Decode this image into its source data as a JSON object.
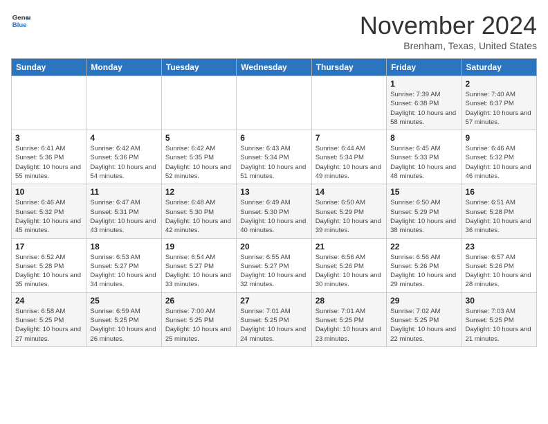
{
  "header": {
    "logo": {
      "general": "General",
      "blue": "Blue"
    },
    "title": "November 2024",
    "location": "Brenham, Texas, United States"
  },
  "weekdays": [
    "Sunday",
    "Monday",
    "Tuesday",
    "Wednesday",
    "Thursday",
    "Friday",
    "Saturday"
  ],
  "weeks": [
    [
      {
        "day": "",
        "info": ""
      },
      {
        "day": "",
        "info": ""
      },
      {
        "day": "",
        "info": ""
      },
      {
        "day": "",
        "info": ""
      },
      {
        "day": "",
        "info": ""
      },
      {
        "day": "1",
        "info": "Sunrise: 7:39 AM\nSunset: 6:38 PM\nDaylight: 10 hours and 58 minutes."
      },
      {
        "day": "2",
        "info": "Sunrise: 7:40 AM\nSunset: 6:37 PM\nDaylight: 10 hours and 57 minutes."
      }
    ],
    [
      {
        "day": "3",
        "info": "Sunrise: 6:41 AM\nSunset: 5:36 PM\nDaylight: 10 hours and 55 minutes."
      },
      {
        "day": "4",
        "info": "Sunrise: 6:42 AM\nSunset: 5:36 PM\nDaylight: 10 hours and 54 minutes."
      },
      {
        "day": "5",
        "info": "Sunrise: 6:42 AM\nSunset: 5:35 PM\nDaylight: 10 hours and 52 minutes."
      },
      {
        "day": "6",
        "info": "Sunrise: 6:43 AM\nSunset: 5:34 PM\nDaylight: 10 hours and 51 minutes."
      },
      {
        "day": "7",
        "info": "Sunrise: 6:44 AM\nSunset: 5:34 PM\nDaylight: 10 hours and 49 minutes."
      },
      {
        "day": "8",
        "info": "Sunrise: 6:45 AM\nSunset: 5:33 PM\nDaylight: 10 hours and 48 minutes."
      },
      {
        "day": "9",
        "info": "Sunrise: 6:46 AM\nSunset: 5:32 PM\nDaylight: 10 hours and 46 minutes."
      }
    ],
    [
      {
        "day": "10",
        "info": "Sunrise: 6:46 AM\nSunset: 5:32 PM\nDaylight: 10 hours and 45 minutes."
      },
      {
        "day": "11",
        "info": "Sunrise: 6:47 AM\nSunset: 5:31 PM\nDaylight: 10 hours and 43 minutes."
      },
      {
        "day": "12",
        "info": "Sunrise: 6:48 AM\nSunset: 5:30 PM\nDaylight: 10 hours and 42 minutes."
      },
      {
        "day": "13",
        "info": "Sunrise: 6:49 AM\nSunset: 5:30 PM\nDaylight: 10 hours and 40 minutes."
      },
      {
        "day": "14",
        "info": "Sunrise: 6:50 AM\nSunset: 5:29 PM\nDaylight: 10 hours and 39 minutes."
      },
      {
        "day": "15",
        "info": "Sunrise: 6:50 AM\nSunset: 5:29 PM\nDaylight: 10 hours and 38 minutes."
      },
      {
        "day": "16",
        "info": "Sunrise: 6:51 AM\nSunset: 5:28 PM\nDaylight: 10 hours and 36 minutes."
      }
    ],
    [
      {
        "day": "17",
        "info": "Sunrise: 6:52 AM\nSunset: 5:28 PM\nDaylight: 10 hours and 35 minutes."
      },
      {
        "day": "18",
        "info": "Sunrise: 6:53 AM\nSunset: 5:27 PM\nDaylight: 10 hours and 34 minutes."
      },
      {
        "day": "19",
        "info": "Sunrise: 6:54 AM\nSunset: 5:27 PM\nDaylight: 10 hours and 33 minutes."
      },
      {
        "day": "20",
        "info": "Sunrise: 6:55 AM\nSunset: 5:27 PM\nDaylight: 10 hours and 32 minutes."
      },
      {
        "day": "21",
        "info": "Sunrise: 6:56 AM\nSunset: 5:26 PM\nDaylight: 10 hours and 30 minutes."
      },
      {
        "day": "22",
        "info": "Sunrise: 6:56 AM\nSunset: 5:26 PM\nDaylight: 10 hours and 29 minutes."
      },
      {
        "day": "23",
        "info": "Sunrise: 6:57 AM\nSunset: 5:26 PM\nDaylight: 10 hours and 28 minutes."
      }
    ],
    [
      {
        "day": "24",
        "info": "Sunrise: 6:58 AM\nSunset: 5:25 PM\nDaylight: 10 hours and 27 minutes."
      },
      {
        "day": "25",
        "info": "Sunrise: 6:59 AM\nSunset: 5:25 PM\nDaylight: 10 hours and 26 minutes."
      },
      {
        "day": "26",
        "info": "Sunrise: 7:00 AM\nSunset: 5:25 PM\nDaylight: 10 hours and 25 minutes."
      },
      {
        "day": "27",
        "info": "Sunrise: 7:01 AM\nSunset: 5:25 PM\nDaylight: 10 hours and 24 minutes."
      },
      {
        "day": "28",
        "info": "Sunrise: 7:01 AM\nSunset: 5:25 PM\nDaylight: 10 hours and 23 minutes."
      },
      {
        "day": "29",
        "info": "Sunrise: 7:02 AM\nSunset: 5:25 PM\nDaylight: 10 hours and 22 minutes."
      },
      {
        "day": "30",
        "info": "Sunrise: 7:03 AM\nSunset: 5:25 PM\nDaylight: 10 hours and 21 minutes."
      }
    ]
  ]
}
